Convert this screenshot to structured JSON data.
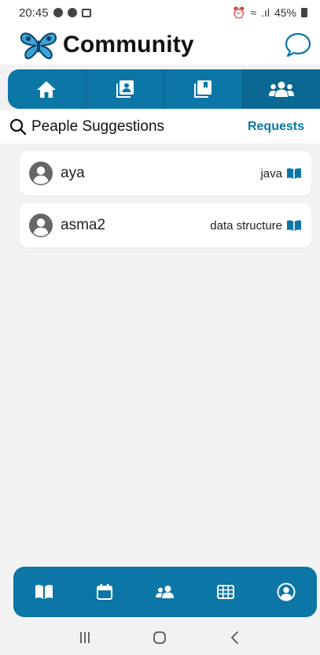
{
  "status_bar": {
    "time": "20:45",
    "battery": "45%"
  },
  "header": {
    "title": "Community"
  },
  "top_tabs": [
    {
      "icon": "home-icon"
    },
    {
      "icon": "contacts-icon"
    },
    {
      "icon": "library-icon"
    },
    {
      "icon": "users-icon",
      "active": true
    }
  ],
  "suggestions": {
    "title": "Peaple Suggestions",
    "requests_label": "Requests"
  },
  "users": [
    {
      "name": "aya",
      "topic": "java"
    },
    {
      "name": "asma2",
      "topic": "data structure"
    }
  ],
  "bottom_nav": [
    {
      "icon": "book-icon"
    },
    {
      "icon": "calendar-icon"
    },
    {
      "icon": "users-icon"
    },
    {
      "icon": "table-icon"
    },
    {
      "icon": "profile-icon"
    }
  ],
  "colors": {
    "primary": "#0c76a6",
    "background": "#f2f2f2"
  }
}
